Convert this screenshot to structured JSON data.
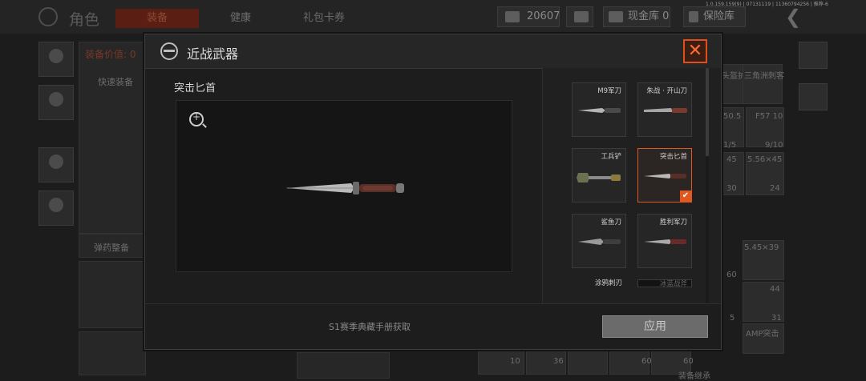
{
  "background": {
    "title": "角色",
    "tabs": [
      "装备",
      "健康",
      "礼包卡券"
    ],
    "currency_amount": "20607",
    "cash_vault": "现金库 0",
    "insurance_vault": "保险库",
    "back_symbol": "❮",
    "version": "1.0.159.159(9) | 07131119 | 11360794256 | 推荐-6",
    "equip_value_label": "装备价值: 0",
    "quick_equip": "快速装备",
    "ammo_organize": "弹药整备",
    "cells": [
      "头盔护",
      "三角洲刺客",
      "50.5",
      "F57 10",
      "1/5",
      "9/10",
      "45",
      "5.56×45",
      "30",
      "24",
      "5.45×39",
      "60",
      "44",
      "5",
      "AMP突击",
      "31",
      "10",
      "36",
      "60",
      "60",
      "装备继承"
    ]
  },
  "dialog": {
    "title": "近战武器",
    "close_symbol": "✕",
    "selected_item_name": "突击匕首",
    "acquire_text": "S1赛季典藏手册获取",
    "apply_label": "应用",
    "items": [
      {
        "name": "M9军刀",
        "selected": false
      },
      {
        "name": "朱战 · 开山刀",
        "selected": false
      },
      {
        "name": "工兵铲",
        "selected": false
      },
      {
        "name": "突击匕首",
        "selected": true
      },
      {
        "name": "鲨鱼刀",
        "selected": false
      },
      {
        "name": "胜利军刀",
        "selected": false
      },
      {
        "name": "涂鸦刺刃",
        "selected": false
      },
      {
        "name": "冰蓝战斧",
        "selected": false
      }
    ]
  },
  "colors": {
    "accent": "#e0571f",
    "dialog_bg": "#1c1d1c",
    "apply_button": "#6a6b6a"
  },
  "icons": [
    "globe-icon",
    "close-icon",
    "zoom-icon",
    "check-icon",
    "currency-icon",
    "back-icon"
  ]
}
